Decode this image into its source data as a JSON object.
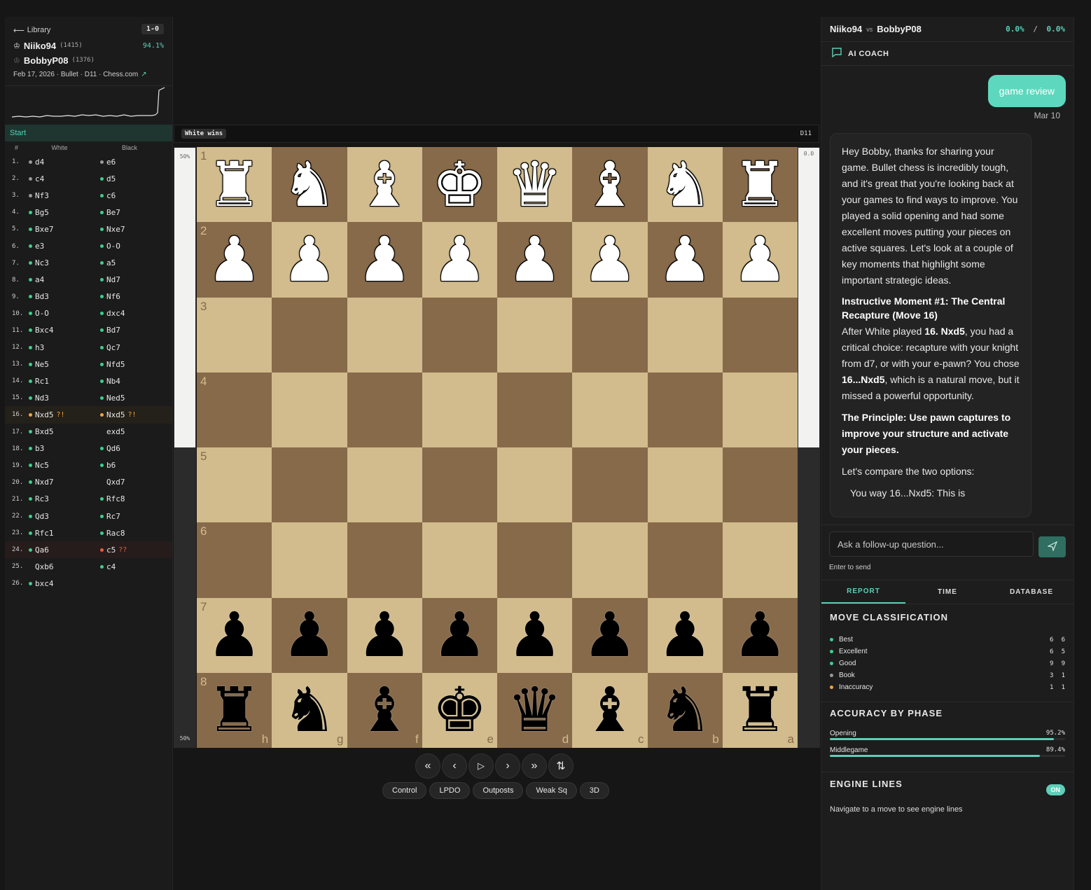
{
  "library": {
    "back_label": "Library",
    "result": "1-0"
  },
  "players": [
    {
      "name": "Niiko94",
      "rating": "(1415)",
      "accuracy": "94.1%"
    },
    {
      "name": "BobbyP08",
      "rating": "(1376)",
      "accuracy": ""
    }
  ],
  "game_meta": "Feb 17, 2026 · Bullet · D11 · Chess.com",
  "moves_header": {
    "start": "Start",
    "num": "#",
    "white": "White",
    "black": "Black"
  },
  "colors": {
    "best": "#3ecf8e",
    "excellent": "#3ecf8e",
    "good": "#3ecf8e",
    "book": "#9a9a9a",
    "inaccuracy": "#f0a63a",
    "blunder": "#e85d3a",
    "accent": "#5ecfb8"
  },
  "moves": [
    {
      "n": "1.",
      "w": "d4",
      "wc": "book",
      "b": "e6",
      "bc": "book"
    },
    {
      "n": "2.",
      "w": "c4",
      "wc": "book",
      "b": "d5",
      "bc": "good"
    },
    {
      "n": "3.",
      "w": "Nf3",
      "wc": "book",
      "b": "c6",
      "bc": "good"
    },
    {
      "n": "4.",
      "w": "Bg5",
      "wc": "good",
      "b": "Be7",
      "bc": "good"
    },
    {
      "n": "5.",
      "w": "Bxe7",
      "wc": "good",
      "b": "Nxe7",
      "bc": "good"
    },
    {
      "n": "6.",
      "w": "e3",
      "wc": "good",
      "b": "O-O",
      "bc": "good"
    },
    {
      "n": "7.",
      "w": "Nc3",
      "wc": "good",
      "b": "a5",
      "bc": "good"
    },
    {
      "n": "8.",
      "w": "a4",
      "wc": "good",
      "b": "Nd7",
      "bc": "good"
    },
    {
      "n": "9.",
      "w": "Bd3",
      "wc": "good",
      "b": "Nf6",
      "bc": "good"
    },
    {
      "n": "10.",
      "w": "O-O",
      "wc": "good",
      "b": "dxc4",
      "bc": "good"
    },
    {
      "n": "11.",
      "w": "Bxc4",
      "wc": "good",
      "b": "Bd7",
      "bc": "good"
    },
    {
      "n": "12.",
      "w": "h3",
      "wc": "good",
      "b": "Qc7",
      "bc": "good"
    },
    {
      "n": "13.",
      "w": "Ne5",
      "wc": "good",
      "b": "Nfd5",
      "bc": "good"
    },
    {
      "n": "14.",
      "w": "Rc1",
      "wc": "good",
      "b": "Nb4",
      "bc": "good"
    },
    {
      "n": "15.",
      "w": "Nd3",
      "wc": "good",
      "b": "Ned5",
      "bc": "good"
    },
    {
      "n": "16.",
      "w": "Nxd5",
      "wc": "inaccuracy",
      "wa": "?!",
      "b": "Nxd5",
      "bc": "inaccuracy",
      "ba": "?!",
      "hl": "orange"
    },
    {
      "n": "17.",
      "w": "Bxd5",
      "wc": "good",
      "b": "exd5",
      "bc": "none"
    },
    {
      "n": "18.",
      "w": "b3",
      "wc": "good",
      "b": "Qd6",
      "bc": "good"
    },
    {
      "n": "19.",
      "w": "Nc5",
      "wc": "good",
      "b": "b6",
      "bc": "good"
    },
    {
      "n": "20.",
      "w": "Nxd7",
      "wc": "good",
      "b": "Qxd7",
      "bc": "none"
    },
    {
      "n": "21.",
      "w": "Rc3",
      "wc": "good",
      "b": "Rfc8",
      "bc": "good"
    },
    {
      "n": "22.",
      "w": "Qd3",
      "wc": "good",
      "b": "Rc7",
      "bc": "good"
    },
    {
      "n": "23.",
      "w": "Rfc1",
      "wc": "good",
      "b": "Rac8",
      "bc": "good"
    },
    {
      "n": "24.",
      "w": "Qa6",
      "wc": "good",
      "b": "c5",
      "bc": "blunder",
      "ba": "??",
      "hl": "red"
    },
    {
      "n": "25.",
      "w": "Qxb6",
      "wc": "none",
      "b": "c4",
      "bc": "good"
    },
    {
      "n": "26.",
      "w": "bxc4",
      "wc": "good",
      "b": "",
      "bc": "none"
    }
  ],
  "board_bar": {
    "status": "White wins",
    "eco": "D11"
  },
  "eval_left": {
    "top": "50%",
    "bottom": "50%",
    "white_share": 0.5
  },
  "eval_right": {
    "top": "0.0",
    "white_share": 0.5
  },
  "board": {
    "ranks": [
      "1",
      "2",
      "3",
      "4",
      "5",
      "6",
      "7",
      "8"
    ],
    "files": [
      "h",
      "g",
      "f",
      "e",
      "d",
      "c",
      "b",
      "a"
    ],
    "rows": [
      [
        "wR",
        "wN",
        "wB",
        "wK",
        "wQ",
        "wB",
        "wN",
        "wR"
      ],
      [
        "wP",
        "wP",
        "wP",
        "wP",
        "wP",
        "wP",
        "wP",
        "wP"
      ],
      [
        "",
        "",
        "",
        "",
        "",
        "",
        "",
        ""
      ],
      [
        "",
        "",
        "",
        "",
        "",
        "",
        "",
        ""
      ],
      [
        "",
        "",
        "",
        "",
        "",
        "",
        "",
        ""
      ],
      [
        "",
        "",
        "",
        "",
        "",
        "",
        "",
        ""
      ],
      [
        "bP",
        "bP",
        "bP",
        "bP",
        "bP",
        "bP",
        "bP",
        "bP"
      ],
      [
        "bR",
        "bN",
        "bB",
        "bK",
        "bQ",
        "bB",
        "bN",
        "bR"
      ]
    ]
  },
  "nav_icons": [
    "first-move-icon",
    "prev-move-icon",
    "play-icon",
    "next-move-icon",
    "last-move-icon",
    "flip-board-icon"
  ],
  "overlays": [
    "Control",
    "LPDO",
    "Outposts",
    "Weak Sq",
    "3D"
  ],
  "right_header": {
    "white": "Niiko94",
    "vs": "vs",
    "black": "BobbyP08",
    "acc_white": "0.0%",
    "acc_sep": "/",
    "acc_black": "0.0%"
  },
  "coach": {
    "title": "AI COACH",
    "user_msg": "game review",
    "user_date": "Mar 10",
    "ai_p1": "Hey Bobby, thanks for sharing your game. Bullet chess is incredibly tough, and it's great that you're looking back at your games to find ways to improve. You played a solid opening and had some excellent moves putting your pieces on active squares. Let's look at a couple of key moments that highlight some important strategic ideas.",
    "ai_h1": "Instructive Moment #1: The Central Recapture (Move 16)",
    "ai_p2a": "After White played ",
    "ai_p2b": "16. Nxd5",
    "ai_p2c": ", you had a critical choice: recapture with your knight from d7, or with your e-pawn? You chose ",
    "ai_p2d": "16...Nxd5",
    "ai_p2e": ", which is a natural move, but it missed a powerful opportunity.",
    "ai_p3": "The Principle: Use pawn captures to improve your structure and activate your pieces.",
    "ai_p4": "Let's compare the two options:",
    "ai_p5": "You way 16...Nxd5: This is",
    "input_placeholder": "Ask a follow-up question...",
    "hint": "Enter to send"
  },
  "tabs": [
    "REPORT",
    "TIME",
    "DATABASE"
  ],
  "classification": {
    "title": "MOVE CLASSIFICATION",
    "rows": [
      {
        "label": "Best",
        "color": "#3ecf8e",
        "w": "6",
        "b": "6"
      },
      {
        "label": "Excellent",
        "color": "#3ecf8e",
        "w": "6",
        "b": "5"
      },
      {
        "label": "Good",
        "color": "#3ecf8e",
        "w": "9",
        "b": "9"
      },
      {
        "label": "Book",
        "color": "#9a9a9a",
        "w": "3",
        "b": "1"
      },
      {
        "label": "Inaccuracy",
        "color": "#f0a63a",
        "w": "1",
        "b": "1"
      }
    ]
  },
  "phases": {
    "title": "ACCURACY BY PHASE",
    "rows": [
      {
        "label": "Opening",
        "pct": "95.2%",
        "value": 95.2
      },
      {
        "label": "Middlegame",
        "pct": "89.4%",
        "value": 89.4
      }
    ]
  },
  "engine": {
    "title": "ENGINE LINES",
    "toggle": "ON",
    "note": "Navigate to a move to see engine lines"
  }
}
